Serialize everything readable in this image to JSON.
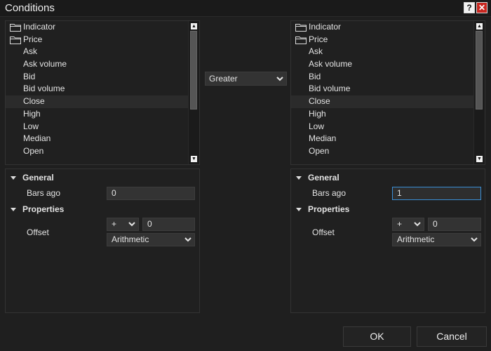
{
  "window": {
    "title": "Conditions",
    "help_label": "?",
    "close_label": "✕"
  },
  "left": {
    "items": [
      {
        "label": "Indicator",
        "type": "folder"
      },
      {
        "label": "Price",
        "type": "folder"
      },
      {
        "label": "Ask",
        "type": "item"
      },
      {
        "label": "Ask volume",
        "type": "item"
      },
      {
        "label": "Bid",
        "type": "item"
      },
      {
        "label": "Bid volume",
        "type": "item"
      },
      {
        "label": "Close",
        "type": "item",
        "selected": true
      },
      {
        "label": "High",
        "type": "item"
      },
      {
        "label": "Low",
        "type": "item"
      },
      {
        "label": "Median",
        "type": "item"
      },
      {
        "label": "Open",
        "type": "item"
      }
    ],
    "general_label": "General",
    "bars_ago_label": "Bars ago",
    "bars_ago_value": "0",
    "properties_label": "Properties",
    "offset_label": "Offset",
    "offset_sign": "+",
    "offset_value": "0",
    "offset_type": "Arithmetic"
  },
  "right": {
    "items": [
      {
        "label": "Indicator",
        "type": "folder"
      },
      {
        "label": "Price",
        "type": "folder"
      },
      {
        "label": "Ask",
        "type": "item"
      },
      {
        "label": "Ask volume",
        "type": "item"
      },
      {
        "label": "Bid",
        "type": "item"
      },
      {
        "label": "Bid volume",
        "type": "item"
      },
      {
        "label": "Close",
        "type": "item",
        "selected": true
      },
      {
        "label": "High",
        "type": "item"
      },
      {
        "label": "Low",
        "type": "item"
      },
      {
        "label": "Median",
        "type": "item"
      },
      {
        "label": "Open",
        "type": "item"
      }
    ],
    "general_label": "General",
    "bars_ago_label": "Bars ago",
    "bars_ago_value": "1",
    "properties_label": "Properties",
    "offset_label": "Offset",
    "offset_sign": "+",
    "offset_value": "0",
    "offset_type": "Arithmetic"
  },
  "comparison": {
    "operator": "Greater"
  },
  "buttons": {
    "ok": "OK",
    "cancel": "Cancel"
  },
  "icons": {
    "folder": "folder-icon",
    "chevron": "chevron-down-icon",
    "section": "triangle-down-icon"
  },
  "colors": {
    "focus": "#3a8fd6",
    "close": "#c8261f"
  }
}
